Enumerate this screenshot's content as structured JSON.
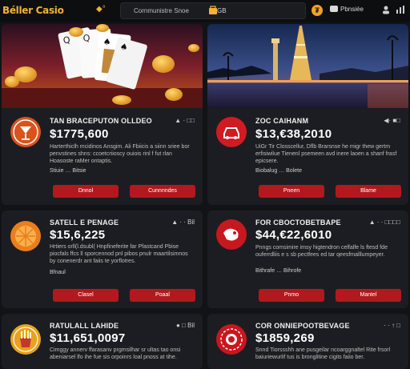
{
  "header": {
    "logo": "Béller Casio",
    "nav_chip": "◆°",
    "search_text": "Cornmunistre Snoe",
    "search_query": "GB",
    "coin_label": "₮",
    "profile_label": "Pbnsiée",
    "icons": [
      "user-icon",
      "chart-icon"
    ]
  },
  "cards": [
    {
      "title": "TAN BRACEPUTON OLLDEO",
      "meta": "▲ · □□",
      "amount": "$1775,600",
      "desc": "Harterthiclh mcidinos Ansgim. Ali Fbiicis a siinn sriee bor penvstines shns: ccoetcriioscy ouiois rinl f fut rlan Hoasoste raMer ontaptis.",
      "foot": "Stiuie … Bitsie",
      "buttons": [
        "Dnnol",
        "Cunnnndes"
      ],
      "icon": "cocktail-icon",
      "icon_color": "#d9531e"
    },
    {
      "title": "ZOC CAIHANM",
      "meta": "◀· ■□",
      "amount": "$13,€38,2010",
      "desc": "UiGr Tir Closscellur, Dflb Brarsnse he migr thew gertm erfisiwilue Tienenl psemeen avd inere laoen a shanf frasf epicsere.",
      "foot": "Biobalug … Bolete",
      "buttons": [
        "Pneen",
        "Blame"
      ],
      "icon": "car-icon",
      "icon_color": "#d01b22"
    },
    {
      "title": "SATELL E PENAGE",
      "meta": "▲ · · Bil",
      "amount": "$15,6,225",
      "desc": "Hrtiers orll(l.dsubl( Hnpfineferite far Pfastcand Pbise piocfals ffcs ll sporcennod pnl pibos pnulr maartilsimnos by conenerdr ant faiis te yorflotres.",
      "foot": "Bfnaul",
      "buttons": [
        "Clasel",
        "Poaal"
      ],
      "icon": "orange-icon",
      "icon_color": "#ec7d1d"
    },
    {
      "title": "FOR CBOCTOBETBAPE",
      "meta": "▲ · · □□□□",
      "amount": "$44,€22,6010",
      "desc": "Pnngs comsimire imsy higtendron celfalfe ls ftesd fde ouferrdliis e s sb pectfees ed tar qeesfmalllumpeyer.",
      "foot": "Bithrafe … Bihrofe",
      "buttons": [
        "Pnmo",
        "Mantel"
      ],
      "icon": "globe-icon",
      "icon_color": "#c7181f"
    },
    {
      "title": "RATULALL LAHIDE",
      "meta": "● □ Bil",
      "amount": "$11,651,0097",
      "desc": "Cimggy annerv ffarasanv prgmsilhar sr ultas tao onsi abeniarsel lfo ihe fue sis orpoinrs loal pnoss at tihe.",
      "foot": "",
      "buttons": [],
      "icon": "fries-icon",
      "icon_color": "#e8a21f"
    },
    {
      "title": "COR ONNIEPOOTBEVAGE",
      "meta": "· · ↑ □",
      "amount": "$1859,269",
      "desc": "Snnd Tiorssshh ane pusgeilar ncoarggnaltel Rite frsorl baiuriewurlif tus is bronglitine cigits faiio ber.",
      "foot": "",
      "buttons": [],
      "icon": "roulette-icon",
      "icon_color": "#c9161e"
    }
  ]
}
